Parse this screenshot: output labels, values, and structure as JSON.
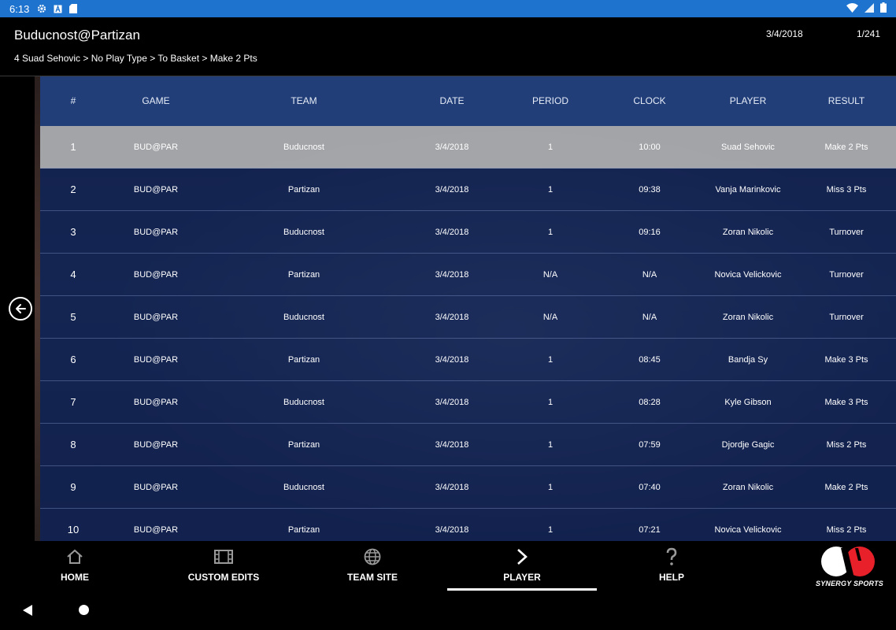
{
  "status_bar": {
    "time": "6:13"
  },
  "header": {
    "title": "Buducnost@Partizan",
    "breadcrumb": "4 Suad Sehovic > No Play Type > To Basket > Make 2 Pts",
    "date": "3/4/2018",
    "count": "1/241"
  },
  "table": {
    "columns": [
      "#",
      "GAME",
      "TEAM",
      "DATE",
      "PERIOD",
      "CLOCK",
      "PLAYER",
      "RESULT"
    ],
    "rows": [
      [
        "1",
        "BUD@PAR",
        "Buducnost",
        "3/4/2018",
        "1",
        "10:00",
        "Suad Sehovic",
        "Make 2 Pts"
      ],
      [
        "2",
        "BUD@PAR",
        "Partizan",
        "3/4/2018",
        "1",
        "09:38",
        "Vanja Marinkovic",
        "Miss 3 Pts"
      ],
      [
        "3",
        "BUD@PAR",
        "Buducnost",
        "3/4/2018",
        "1",
        "09:16",
        "Zoran Nikolic",
        "Turnover"
      ],
      [
        "4",
        "BUD@PAR",
        "Partizan",
        "3/4/2018",
        "N/A",
        "N/A",
        "Novica Velickovic",
        "Turnover"
      ],
      [
        "5",
        "BUD@PAR",
        "Buducnost",
        "3/4/2018",
        "N/A",
        "N/A",
        "Zoran Nikolic",
        "Turnover"
      ],
      [
        "6",
        "BUD@PAR",
        "Partizan",
        "3/4/2018",
        "1",
        "08:45",
        "Bandja Sy",
        "Make 3 Pts"
      ],
      [
        "7",
        "BUD@PAR",
        "Buducnost",
        "3/4/2018",
        "1",
        "08:28",
        "Kyle Gibson",
        "Make 3 Pts"
      ],
      [
        "8",
        "BUD@PAR",
        "Partizan",
        "3/4/2018",
        "1",
        "07:59",
        "Djordje Gagic",
        "Miss 2 Pts"
      ],
      [
        "9",
        "BUD@PAR",
        "Buducnost",
        "3/4/2018",
        "1",
        "07:40",
        "Zoran Nikolic",
        "Make 2 Pts"
      ],
      [
        "10",
        "BUD@PAR",
        "Partizan",
        "3/4/2018",
        "1",
        "07:21",
        "Novica Velickovic",
        "Miss 2 Pts"
      ]
    ],
    "selected_row": 1
  },
  "nav": {
    "items": [
      {
        "label": "HOME",
        "icon": "home-icon"
      },
      {
        "label": "CUSTOM EDITS",
        "icon": "film-icon"
      },
      {
        "label": "TEAM SITE",
        "icon": "globe-icon"
      },
      {
        "label": "PLAYER",
        "icon": "chevron-right-icon"
      },
      {
        "label": "HELP",
        "icon": "question-icon"
      }
    ],
    "active": "PLAYER"
  },
  "logo": {
    "text": "SYNERGY SPORTS",
    "accent": "#e8202a"
  },
  "colors": {
    "status_bar": "#1e73cf",
    "header_row": "#22407c",
    "row_bg": "#0f1e4b",
    "selected_row": "#afafaf"
  }
}
